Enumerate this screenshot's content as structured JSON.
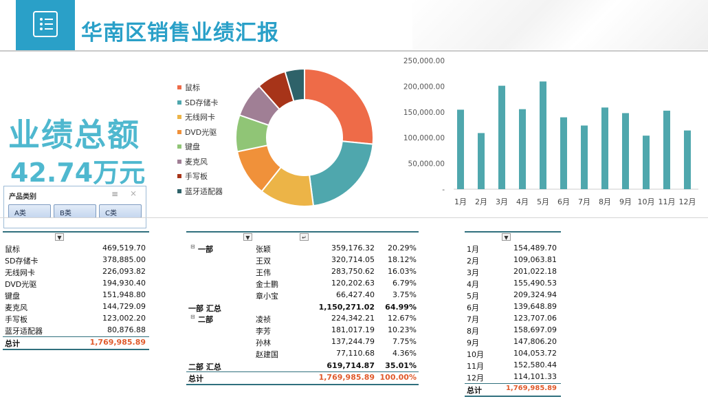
{
  "header": {
    "title": "华南区销售业绩汇报",
    "menu_icon": "list-icon"
  },
  "kpi": {
    "label": "业绩总额",
    "value": "42.74万元"
  },
  "slicer": {
    "title": "产品类别",
    "multi_select_icon": "multi-select-icon",
    "clear_icon": "clear-filter-icon",
    "items": [
      "A类",
      "B类",
      "C类"
    ]
  },
  "colors": {
    "accent": "#2aa0c8",
    "kpi": "#4fb8cf",
    "bar": "#4fa7ad",
    "total_red": "#e05a2b",
    "rule": "#2f6f7d"
  },
  "chart_data": [
    {
      "type": "pie",
      "donut": true,
      "categories": [
        "鼠标",
        "SD存储卡",
        "无线网卡",
        "DVD光驱",
        "键盘",
        "麦克风",
        "手写板",
        "蓝牙适配器"
      ],
      "values": [
        469519.7,
        378885.0,
        226093.82,
        194930.4,
        151948.8,
        144729.09,
        123002.2,
        80876.88
      ],
      "colors": [
        "#ee6b48",
        "#4fa7ad",
        "#ecb447",
        "#f0913a",
        "#90c576",
        "#a07f95",
        "#a73419",
        "#2e6269"
      ],
      "legend": "left"
    },
    {
      "type": "bar",
      "categories": [
        "1月",
        "2月",
        "3月",
        "4月",
        "5月",
        "6月",
        "7月",
        "8月",
        "9月",
        "10月",
        "11月",
        "12月"
      ],
      "values": [
        154489.7,
        109063.81,
        201022.18,
        155490.53,
        209324.94,
        139648.89,
        123707.06,
        158697.09,
        147806.2,
        104053.72,
        152580.44,
        114101.33
      ],
      "ylim": [
        0,
        250000
      ],
      "yticks": [
        "250,000.00",
        "200,000.00",
        "150,000.00",
        "100,000.00",
        "50,000.00",
        "-"
      ],
      "grid": false
    }
  ],
  "table_products": {
    "filter_icon": "dropdown-filter-icon",
    "rows": [
      {
        "name": "鼠标",
        "value": "469,519.70"
      },
      {
        "name": "SD存储卡",
        "value": "378,885.00"
      },
      {
        "name": "无线网卡",
        "value": "226,093.82"
      },
      {
        "name": "DVD光驱",
        "value": "194,930.40"
      },
      {
        "name": "键盘",
        "value": "151,948.80"
      },
      {
        "name": "麦克风",
        "value": "144,729.09"
      },
      {
        "name": "手写板",
        "value": "123,002.20"
      },
      {
        "name": "蓝牙适配器",
        "value": "80,876.88"
      }
    ],
    "total_label": "总计",
    "total_value": "1,769,985.89"
  },
  "table_staff": {
    "groups": [
      {
        "dept": "一部",
        "rows": [
          {
            "name": "张颖",
            "value": "359,176.32",
            "pct": "20.29%"
          },
          {
            "name": "王双",
            "value": "320,714.05",
            "pct": "18.12%"
          },
          {
            "name": "王伟",
            "value": "283,750.62",
            "pct": "16.03%"
          },
          {
            "name": "金士鹏",
            "value": "120,202.63",
            "pct": "6.79%"
          },
          {
            "name": "章小宝",
            "value": "66,427.40",
            "pct": "3.75%"
          }
        ],
        "subtotal_label": "一部 汇总",
        "subtotal_value": "1,150,271.02",
        "subtotal_pct": "64.99%"
      },
      {
        "dept": "二部",
        "rows": [
          {
            "name": "凌祯",
            "value": "224,342.21",
            "pct": "12.67%"
          },
          {
            "name": "李芳",
            "value": "181,017.19",
            "pct": "10.23%"
          },
          {
            "name": "孙林",
            "value": "137,244.79",
            "pct": "7.75%"
          },
          {
            "name": "赵建国",
            "value": "77,110.68",
            "pct": "4.36%"
          }
        ],
        "subtotal_label": "二部 汇总",
        "subtotal_value": "619,714.87",
        "subtotal_pct": "35.01%"
      }
    ],
    "total_label": "总计",
    "total_value": "1,769,985.89",
    "total_pct": "100.00%"
  },
  "table_months": {
    "rows": [
      {
        "month": "1月",
        "value": "154,489.70"
      },
      {
        "month": "2月",
        "value": "109,063.81"
      },
      {
        "month": "3月",
        "value": "201,022.18"
      },
      {
        "month": "4月",
        "value": "155,490.53"
      },
      {
        "month": "5月",
        "value": "209,324.94"
      },
      {
        "month": "6月",
        "value": "139,648.89"
      },
      {
        "month": "7月",
        "value": "123,707.06"
      },
      {
        "month": "8月",
        "value": "158,697.09"
      },
      {
        "month": "9月",
        "value": "147,806.20"
      },
      {
        "month": "10月",
        "value": "104,053.72"
      },
      {
        "month": "11月",
        "value": "152,580.44"
      },
      {
        "month": "12月",
        "value": "114,101.33"
      }
    ],
    "total_label": "总计",
    "total_value": "1,769,985.89"
  }
}
